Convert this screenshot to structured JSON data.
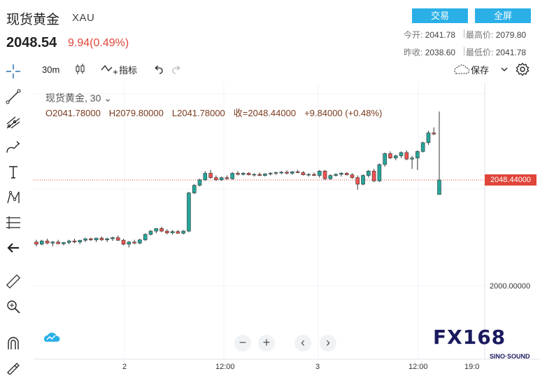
{
  "header": {
    "name": "现货黄金",
    "symbol": "XAU",
    "price": "2048.54",
    "change": "9.94(0.49%)",
    "trade_button": "交易",
    "fullscreen_button": "全屏",
    "stats": {
      "open_label": "今开:",
      "open_value": "2041.78",
      "high_label": "最高价:",
      "high_value": "2079.80",
      "prev_close_label": "昨收:",
      "prev_close_value": "2038.60",
      "low_label": "最低价:",
      "low_value": "2041.78"
    }
  },
  "toolbar": {
    "interval": "30m",
    "indicators_label": "指标",
    "save_label": "保存"
  },
  "legend": {
    "title": "现货黄金, 30",
    "open": "O2041.78000",
    "high": "H2079.80000",
    "low": "L2041.78000",
    "close": "收=2048.44000",
    "change": "+9.84000 (+0.48%)"
  },
  "axis": {
    "current_price": "2048.44000",
    "price_tick": "2000.00000",
    "time_ticks": [
      "2",
      "12:00",
      "3",
      "12:00",
      "19:0"
    ]
  },
  "watermark": {
    "logo": "FX168",
    "sub": "SINO·SOUND"
  },
  "colors": {
    "up": "#26a69a",
    "down": "#ef5350",
    "accent": "#2ab0e7",
    "price_line": "#e0453a"
  },
  "chart_data": {
    "type": "candlestick",
    "interval": "30m",
    "last_price": 2048.44,
    "y_tick": 2000.0,
    "x_ticks": [
      "2",
      "12:00",
      "3",
      "12:00",
      "19:0"
    ],
    "candles": [
      [
        2020.0,
        2021.0,
        2018.0,
        2019.0
      ],
      [
        2019.0,
        2021.0,
        2018.5,
        2020.5
      ],
      [
        2020.5,
        2021.5,
        2019.0,
        2019.5
      ],
      [
        2019.5,
        2020.5,
        2018.0,
        2020.0
      ],
      [
        2020.0,
        2021.0,
        2019.0,
        2019.2
      ],
      [
        2019.2,
        2020.0,
        2018.5,
        2019.8
      ],
      [
        2019.8,
        2021.0,
        2019.0,
        2020.5
      ],
      [
        2020.5,
        2021.5,
        2019.5,
        2020.0
      ],
      [
        2020.0,
        2021.0,
        2019.0,
        2020.8
      ],
      [
        2020.8,
        2022.0,
        2020.0,
        2021.5
      ],
      [
        2021.5,
        2022.0,
        2020.5,
        2021.0
      ],
      [
        2021.0,
        2022.0,
        2020.0,
        2021.8
      ],
      [
        2021.8,
        2022.5,
        2020.5,
        2021.0
      ],
      [
        2021.0,
        2022.0,
        2020.0,
        2021.5
      ],
      [
        2021.5,
        2022.5,
        2020.5,
        2022.0
      ],
      [
        2022.0,
        2023.0,
        2020.5,
        2020.8
      ],
      [
        2020.8,
        2021.5,
        2018.5,
        2019.0
      ],
      [
        2019.0,
        2020.5,
        2017.5,
        2020.0
      ],
      [
        2020.0,
        2021.0,
        2019.0,
        2019.5
      ],
      [
        2019.5,
        2021.5,
        2019.0,
        2021.0
      ],
      [
        2021.0,
        2024.0,
        2020.5,
        2023.5
      ],
      [
        2023.5,
        2025.5,
        2023.0,
        2025.0
      ],
      [
        2025.0,
        2026.0,
        2024.0,
        2026.2
      ],
      [
        2026.2,
        2027.0,
        2024.5,
        2025.0
      ],
      [
        2025.0,
        2025.8,
        2023.5,
        2024.2
      ],
      [
        2024.2,
        2025.5,
        2023.5,
        2024.8
      ],
      [
        2024.8,
        2025.5,
        2023.8,
        2024.0
      ],
      [
        2024.0,
        2025.5,
        2023.5,
        2025.0
      ],
      [
        2025.0,
        2043.0,
        2024.5,
        2042.5
      ],
      [
        2042.5,
        2046.5,
        2042.0,
        2046.0
      ],
      [
        2046.0,
        2049.0,
        2045.5,
        2048.5
      ],
      [
        2048.5,
        2052.5,
        2048.0,
        2051.5
      ],
      [
        2051.5,
        2053.0,
        2049.0,
        2049.5
      ],
      [
        2049.5,
        2050.5,
        2048.0,
        2048.5
      ],
      [
        2048.5,
        2050.0,
        2048.0,
        2049.5
      ],
      [
        2049.5,
        2050.5,
        2048.5,
        2049.0
      ],
      [
        2049.0,
        2052.0,
        2048.5,
        2051.5
      ],
      [
        2051.5,
        2052.5,
        2050.5,
        2051.0
      ],
      [
        2051.0,
        2052.0,
        2050.5,
        2051.5
      ],
      [
        2051.5,
        2052.0,
        2050.5,
        2050.8
      ],
      [
        2050.8,
        2051.5,
        2050.0,
        2051.0
      ],
      [
        2051.0,
        2051.8,
        2050.2,
        2050.5
      ],
      [
        2050.5,
        2051.5,
        2050.0,
        2051.2
      ],
      [
        2051.2,
        2052.0,
        2050.5,
        2051.5
      ],
      [
        2051.5,
        2052.2,
        2050.8,
        2051.8
      ],
      [
        2051.8,
        2052.5,
        2051.0,
        2052.0
      ],
      [
        2052.0,
        2052.8,
        2051.0,
        2051.5
      ],
      [
        2051.5,
        2052.5,
        2050.8,
        2052.2
      ],
      [
        2052.2,
        2053.0,
        2051.5,
        2051.8
      ],
      [
        2051.8,
        2052.5,
        2050.5,
        2050.8
      ],
      [
        2050.8,
        2051.5,
        2050.0,
        2051.0
      ],
      [
        2051.0,
        2051.8,
        2050.2,
        2050.5
      ],
      [
        2050.5,
        2053.0,
        2049.5,
        2052.5
      ],
      [
        2052.5,
        2053.0,
        2048.5,
        2049.0
      ],
      [
        2049.0,
        2051.0,
        2048.5,
        2050.5
      ],
      [
        2050.5,
        2051.5,
        2050.0,
        2051.0
      ],
      [
        2051.0,
        2052.0,
        2050.0,
        2051.5
      ],
      [
        2051.5,
        2052.0,
        2050.5,
        2050.8
      ],
      [
        2050.8,
        2051.5,
        2049.0,
        2049.5
      ],
      [
        2049.5,
        2050.5,
        2044.0,
        2046.5
      ],
      [
        2046.5,
        2051.0,
        2046.0,
        2050.5
      ],
      [
        2050.5,
        2053.0,
        2049.5,
        2052.5
      ],
      [
        2052.5,
        2053.5,
        2047.5,
        2048.0
      ],
      [
        2048.0,
        2056.0,
        2047.5,
        2055.5
      ],
      [
        2055.5,
        2061.0,
        2054.5,
        2060.5
      ],
      [
        2060.5,
        2061.5,
        2058.0,
        2058.5
      ],
      [
        2058.5,
        2060.0,
        2057.5,
        2059.5
      ],
      [
        2059.5,
        2061.5,
        2058.5,
        2061.0
      ],
      [
        2061.0,
        2062.0,
        2057.5,
        2058.0
      ],
      [
        2058.0,
        2059.5,
        2053.5,
        2058.5
      ],
      [
        2058.5,
        2062.0,
        2053.0,
        2061.5
      ],
      [
        2061.5,
        2066.0,
        2061.0,
        2065.5
      ],
      [
        2065.5,
        2071.0,
        2064.5,
        2070.0
      ],
      [
        2070.0,
        2072.5,
        2069.0,
        2069.5
      ],
      [
        2041.78,
        2079.8,
        2041.78,
        2048.44
      ]
    ]
  }
}
